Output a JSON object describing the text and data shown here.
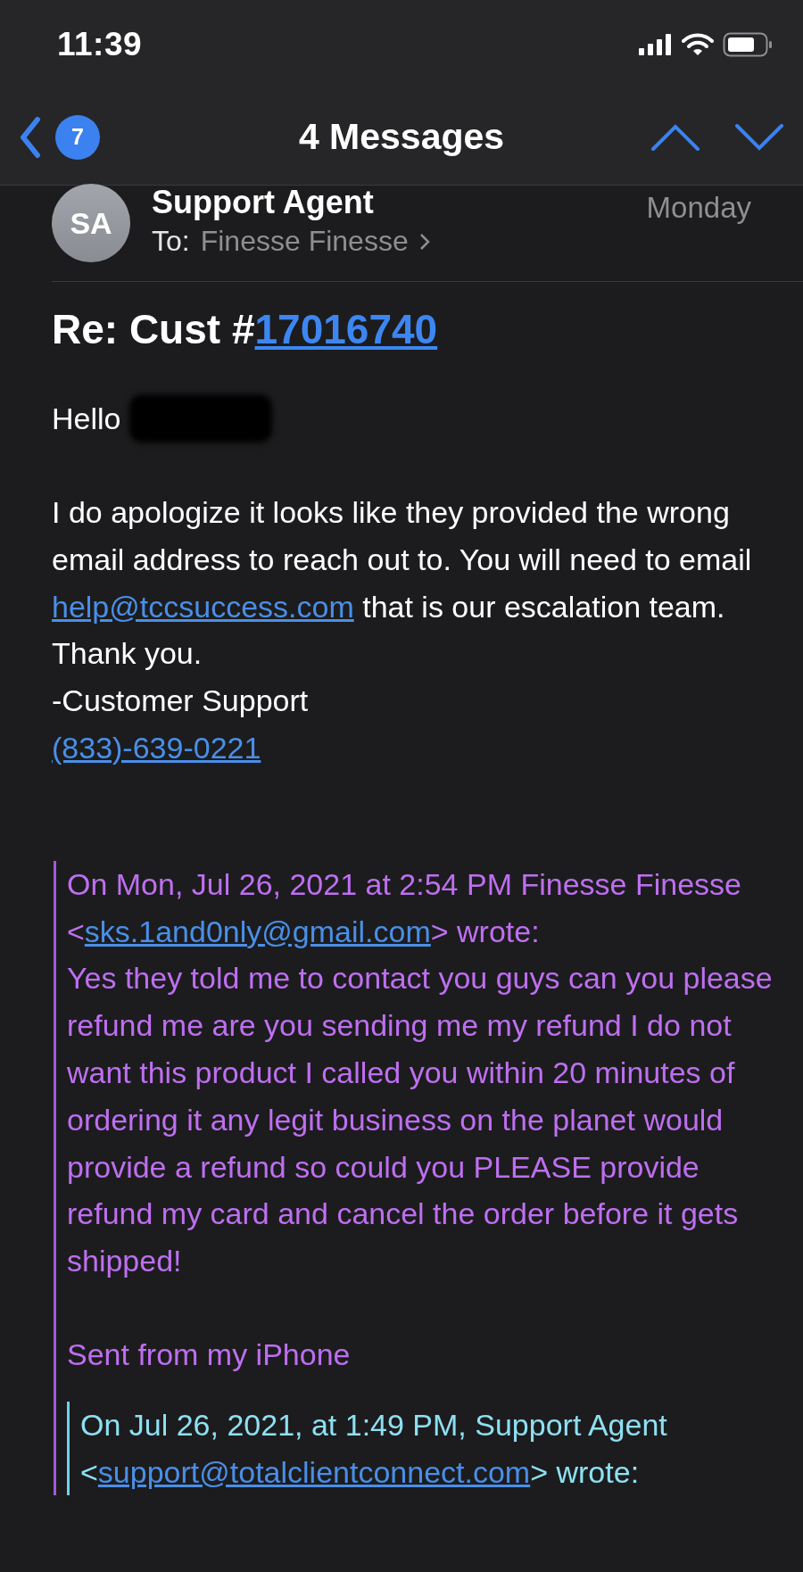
{
  "status_bar": {
    "time": "11:39"
  },
  "nav": {
    "unread_count": "7",
    "title": "4 Messages"
  },
  "message": {
    "avatar": "SA",
    "sender": "Support Agent",
    "to_label": "To:",
    "recipient": "Finesse Finesse",
    "date": "Monday",
    "subject": [
      {
        "text": "Re: Cust #"
      },
      {
        "text": "17016740",
        "link": true
      }
    ],
    "greeting": "Hello",
    "body": [
      {
        "segments": [
          {
            "text": "I do apologize it looks like they provided the wrong email address to reach out to. You will need to email "
          },
          {
            "text": "help@tccsuccess.com",
            "link": true
          },
          {
            "text": " that is our escalation team. Thank you."
          }
        ]
      },
      {
        "segments": [
          {
            "text": "-Customer Support"
          }
        ]
      },
      {
        "segments": [
          {
            "text": "(833)-639-0221",
            "link": true
          }
        ]
      }
    ],
    "quote": {
      "header": [
        {
          "text": "On Mon, Jul 26, 2021 at 2:54 PM Finesse Finesse <"
        },
        {
          "text": "sks.1and0nly@gmail.com",
          "link": true
        },
        {
          "text": "> wrote:"
        }
      ],
      "paragraphs": [
        {
          "segments": [
            {
              "text": "Yes they told me to contact you guys can you please refund me are you sending me my refund I do not want this product I called you within 20 minutes of ordering it any legit business on the planet would provide a refund so could you PLEASE provide refund my card and cancel the order before it gets shipped!"
            }
          ]
        },
        {
          "segments": [
            {
              "text": "Sent from my iPhone"
            }
          ]
        }
      ],
      "nested": {
        "paragraphs": [
          {
            "segments": [
              {
                "text": "On Jul 26, 2021, at 1:49 PM, Support Agent"
              }
            ]
          },
          {
            "segments": [
              {
                "text": "<"
              },
              {
                "text": "support@totalclientconnect.com",
                "link": true
              },
              {
                "text": "> wrote:"
              }
            ]
          }
        ]
      }
    }
  }
}
